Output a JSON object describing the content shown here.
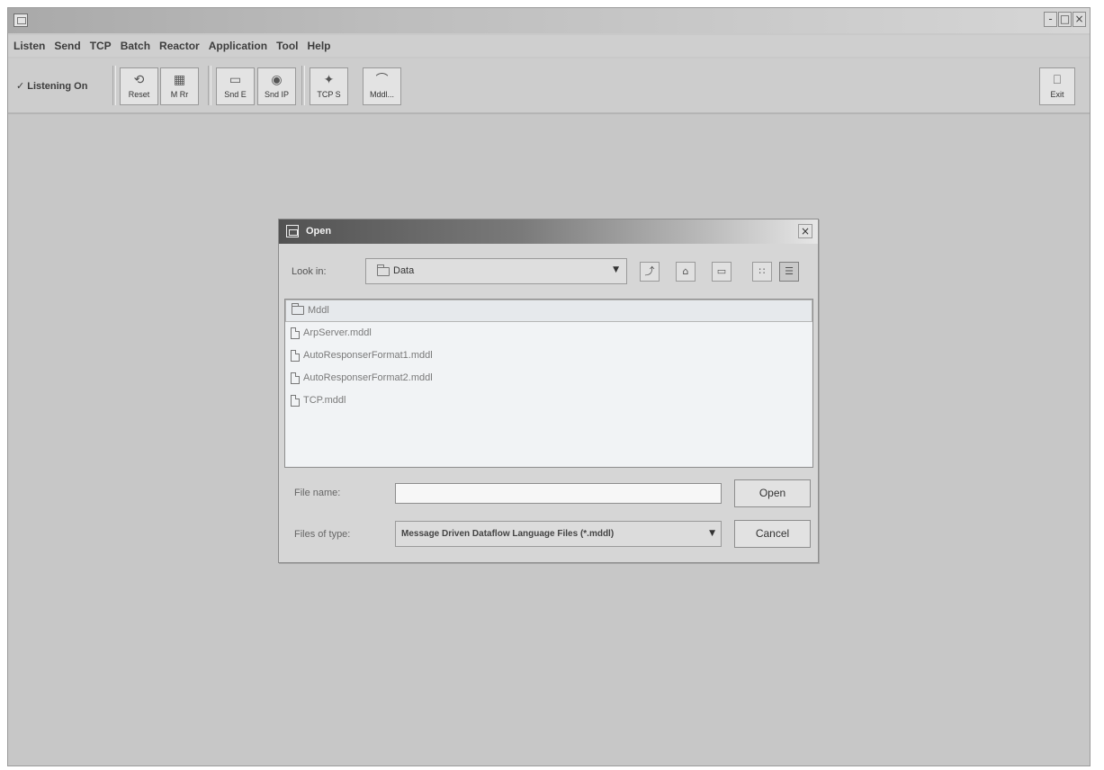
{
  "window": {
    "title": "",
    "controls": [
      "-",
      "□",
      "×"
    ]
  },
  "menu": [
    "Listen",
    "Send",
    "TCP",
    "Batch",
    "Reactor",
    "Application",
    "Tool",
    "Help"
  ],
  "toolbar": {
    "listening_check": "✓",
    "listening_label": "Listening On",
    "buttons": [
      {
        "label": "Reset",
        "icon": "reset-icon",
        "glyph": "⟲"
      },
      {
        "label": "M Rr",
        "icon": "message-reader-icon",
        "glyph": "▦"
      },
      {
        "label": "Snd E",
        "icon": "send-ethernet-icon",
        "glyph": "▭"
      },
      {
        "label": "Snd IP",
        "icon": "send-ip-icon",
        "glyph": "◉"
      },
      {
        "label": "TCP S",
        "icon": "tcp-server-icon",
        "glyph": "✦"
      },
      {
        "label": "Mddl...",
        "icon": "mddl-icon",
        "glyph": "⌒"
      }
    ],
    "exit": {
      "label": "Exit",
      "icon": "exit-icon",
      "glyph": "⎕"
    }
  },
  "dialog": {
    "title": "Open",
    "close_glyph": "×",
    "look_in_label": "Look in:",
    "look_in_value": "Data",
    "look_in_arrow": "▼",
    "nav_buttons": [
      {
        "name": "up-one-level-icon",
        "glyph": "⤴"
      },
      {
        "name": "home-icon",
        "glyph": "⌂"
      },
      {
        "name": "new-folder-icon",
        "glyph": "▭"
      },
      {
        "name": "list-view-icon",
        "glyph": "∷"
      },
      {
        "name": "details-view-icon",
        "glyph": "☰"
      }
    ],
    "files": [
      {
        "name": "Mddl",
        "type": "folder",
        "selected": true
      },
      {
        "name": "ArpServer.mddl",
        "type": "file"
      },
      {
        "name": "AutoResponserFormat1.mddl",
        "type": "file"
      },
      {
        "name": "AutoResponserFormat2.mddl",
        "type": "file"
      },
      {
        "name": "TCP.mddl",
        "type": "file"
      }
    ],
    "file_name_label": "File name:",
    "file_name_value": "",
    "files_of_type_label": "Files of type:",
    "files_of_type_value": "Message Driven Dataflow Language Files (*.mddl)",
    "files_of_type_arrow": "▼",
    "open_label": "Open",
    "cancel_label": "Cancel"
  }
}
